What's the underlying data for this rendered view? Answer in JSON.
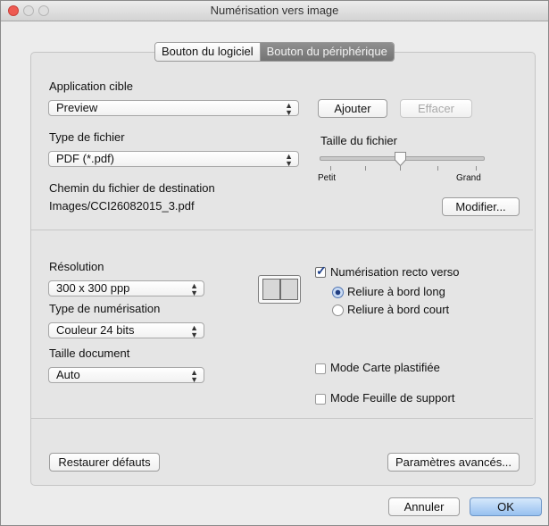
{
  "window": {
    "title": "Numérisation vers image"
  },
  "tabs": [
    {
      "label": "Bouton du logiciel"
    },
    {
      "label": "Bouton du périphérique"
    }
  ],
  "target_app": {
    "label": "Application cible",
    "value": "Preview",
    "add_button": "Ajouter",
    "remove_button": "Effacer"
  },
  "file_type": {
    "label": "Type de fichier",
    "value": "PDF (*.pdf)"
  },
  "file_size": {
    "label": "Taille du fichier",
    "min_label": "Petit",
    "max_label": "Grand",
    "level": 0.5
  },
  "destination": {
    "label": "Chemin du fichier de destination",
    "path": "Images/CCI26082015_3.pdf",
    "modify_button": "Modifier..."
  },
  "resolution": {
    "label": "Résolution",
    "value": "300 x 300 ppp"
  },
  "scan_type": {
    "label": "Type de numérisation",
    "value": "Couleur 24 bits"
  },
  "document_size": {
    "label": "Taille document",
    "value": "Auto"
  },
  "duplex": {
    "label": "Numérisation recto verso",
    "checked": true,
    "long_edge": "Reliure à bord long",
    "short_edge": "Reliure à bord court"
  },
  "options": {
    "plastic_card": "Mode Carte plastifiée",
    "carrier_sheet": "Mode Feuille de support"
  },
  "footer": {
    "restore_button": "Restaurer défauts",
    "advanced_button": "Paramètres avancés...",
    "cancel_button": "Annuler",
    "ok_button": "OK"
  },
  "colors": {
    "default_button": "#97c1f0",
    "active_tab": "#7e7e7e",
    "checkmark": "#1d3f8a"
  }
}
